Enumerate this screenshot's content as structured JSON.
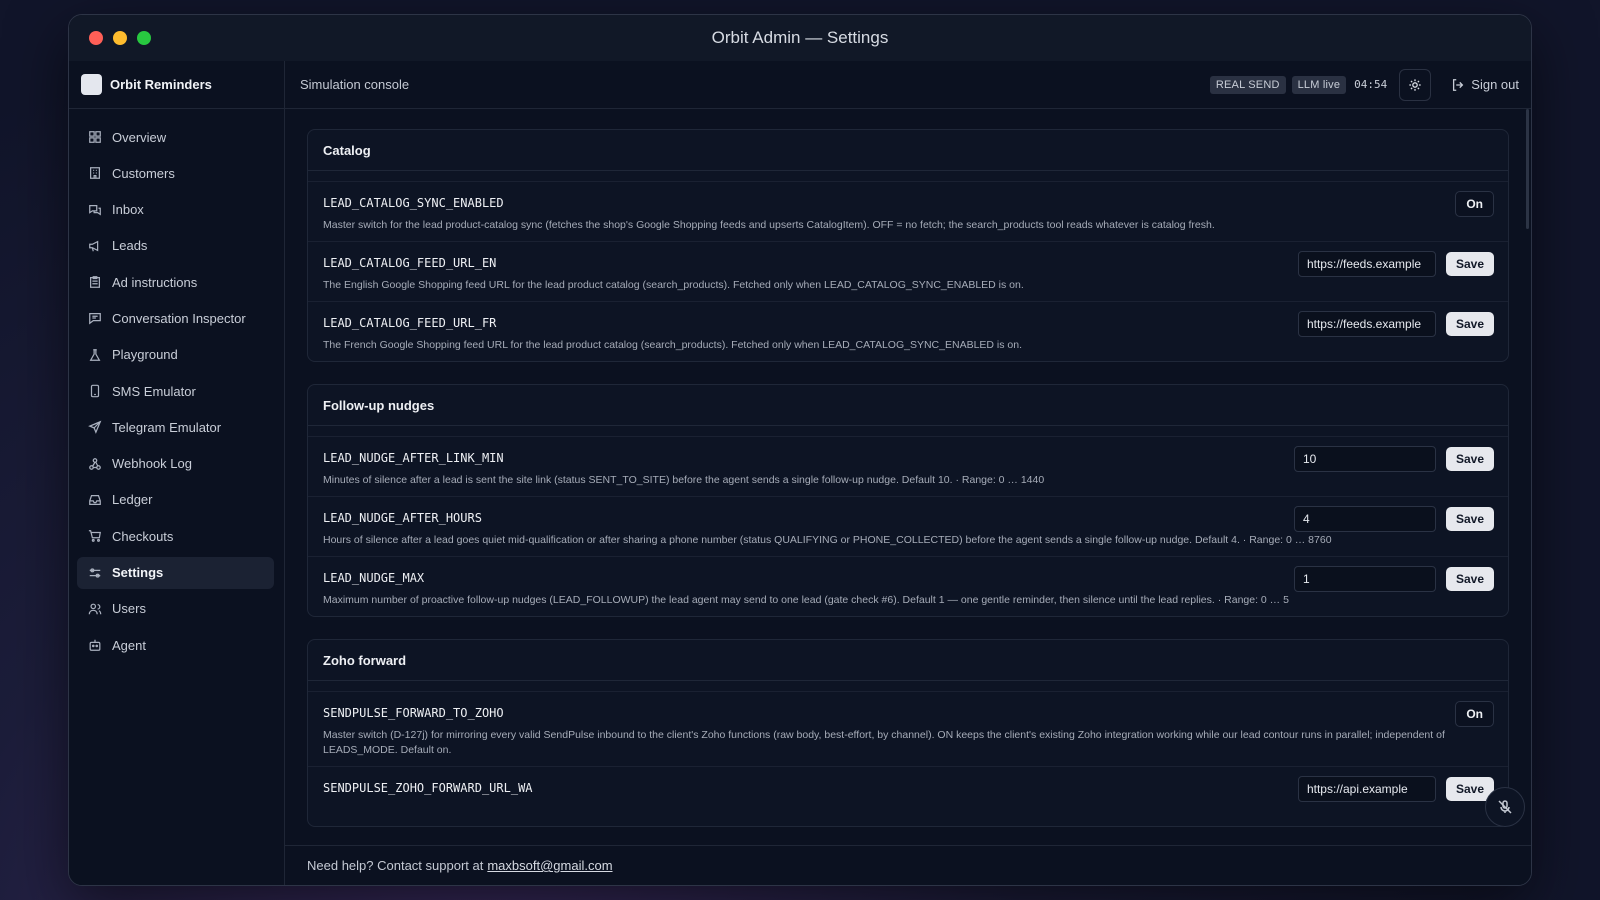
{
  "window": {
    "title": "Orbit Admin — Settings"
  },
  "brand": {
    "name": "Orbit Reminders"
  },
  "sidebar": {
    "items": [
      {
        "label": "Overview",
        "icon": "grid-icon"
      },
      {
        "label": "Customers",
        "icon": "building-icon"
      },
      {
        "label": "Inbox",
        "icon": "messages-icon"
      },
      {
        "label": "Leads",
        "icon": "megaphone-icon"
      },
      {
        "label": "Ad instructions",
        "icon": "clipboard-icon"
      },
      {
        "label": "Conversation Inspector",
        "icon": "chat-icon"
      },
      {
        "label": "Playground",
        "icon": "flask-icon"
      },
      {
        "label": "SMS Emulator",
        "icon": "phone-icon"
      },
      {
        "label": "Telegram Emulator",
        "icon": "send-icon"
      },
      {
        "label": "Webhook Log",
        "icon": "webhook-icon"
      },
      {
        "label": "Ledger",
        "icon": "inbox-icon"
      },
      {
        "label": "Checkouts",
        "icon": "cart-icon"
      },
      {
        "label": "Settings",
        "icon": "sliders-icon",
        "active": true
      },
      {
        "label": "Users",
        "icon": "users-icon"
      },
      {
        "label": "Agent",
        "icon": "bot-icon"
      }
    ]
  },
  "topbar": {
    "crumb": "Simulation console",
    "badge_send": "REAL SEND",
    "badge_llm": "LLM live",
    "clock": "04:54",
    "signout": "Sign out"
  },
  "sections": {
    "catalog": {
      "title": "Catalog",
      "rows": [
        {
          "key": "LEAD_CATALOG_SYNC_ENABLED",
          "desc": "Master switch for the lead product-catalog sync (fetches the shop's Google Shopping feeds and upserts CatalogItem). OFF = no fetch; the search_products tool reads whatever is catalog fresh.",
          "toggle": "On"
        },
        {
          "key": "LEAD_CATALOG_FEED_URL_EN",
          "desc": "The English Google Shopping feed URL for the lead product catalog (search_products). Fetched only when LEAD_CATALOG_SYNC_ENABLED is on.",
          "value": "https://feeds.example",
          "save": "Save"
        },
        {
          "key": "LEAD_CATALOG_FEED_URL_FR",
          "desc": "The French Google Shopping feed URL for the lead product catalog (search_products). Fetched only when LEAD_CATALOG_SYNC_ENABLED is on.",
          "value": "https://feeds.example",
          "save": "Save"
        }
      ]
    },
    "nudges": {
      "title": "Follow-up nudges",
      "rows": [
        {
          "key": "LEAD_NUDGE_AFTER_LINK_MIN",
          "desc": "Minutes of silence after a lead is sent the site link (status SENT_TO_SITE) before the agent sends a single follow-up nudge. Default 10. · Range: 0 … 1440",
          "value": "10",
          "save": "Save"
        },
        {
          "key": "LEAD_NUDGE_AFTER_HOURS",
          "desc": "Hours of silence after a lead goes quiet mid-qualification or after sharing a phone number (status QUALIFYING or PHONE_COLLECTED) before the agent sends a single follow-up nudge. Default 4. · Range: 0 … 8760",
          "value": "4",
          "save": "Save"
        },
        {
          "key": "LEAD_NUDGE_MAX",
          "desc": "Maximum number of proactive follow-up nudges (LEAD_FOLLOWUP) the lead agent may send to one lead (gate check #6). Default 1 — one gentle reminder, then silence until the lead replies. · Range: 0 … 5",
          "value": "1",
          "save": "Save"
        }
      ]
    },
    "zoho": {
      "title": "Zoho forward",
      "rows": [
        {
          "key": "SENDPULSE_FORWARD_TO_ZOHO",
          "desc": "Master switch (D-127j) for mirroring every valid SendPulse inbound to the client's Zoho functions (raw body, best-effort, by channel). ON keeps the client's existing Zoho integration working while our lead contour runs in parallel; independent of LEADS_MODE. Default on.",
          "toggle": "On"
        },
        {
          "key": "SENDPULSE_ZOHO_FORWARD_URL_WA",
          "value": "https://api.example",
          "save": "Save"
        }
      ]
    }
  },
  "footer": {
    "text": "Need help? Contact support at",
    "email": "maxbsoft@gmail.com"
  }
}
